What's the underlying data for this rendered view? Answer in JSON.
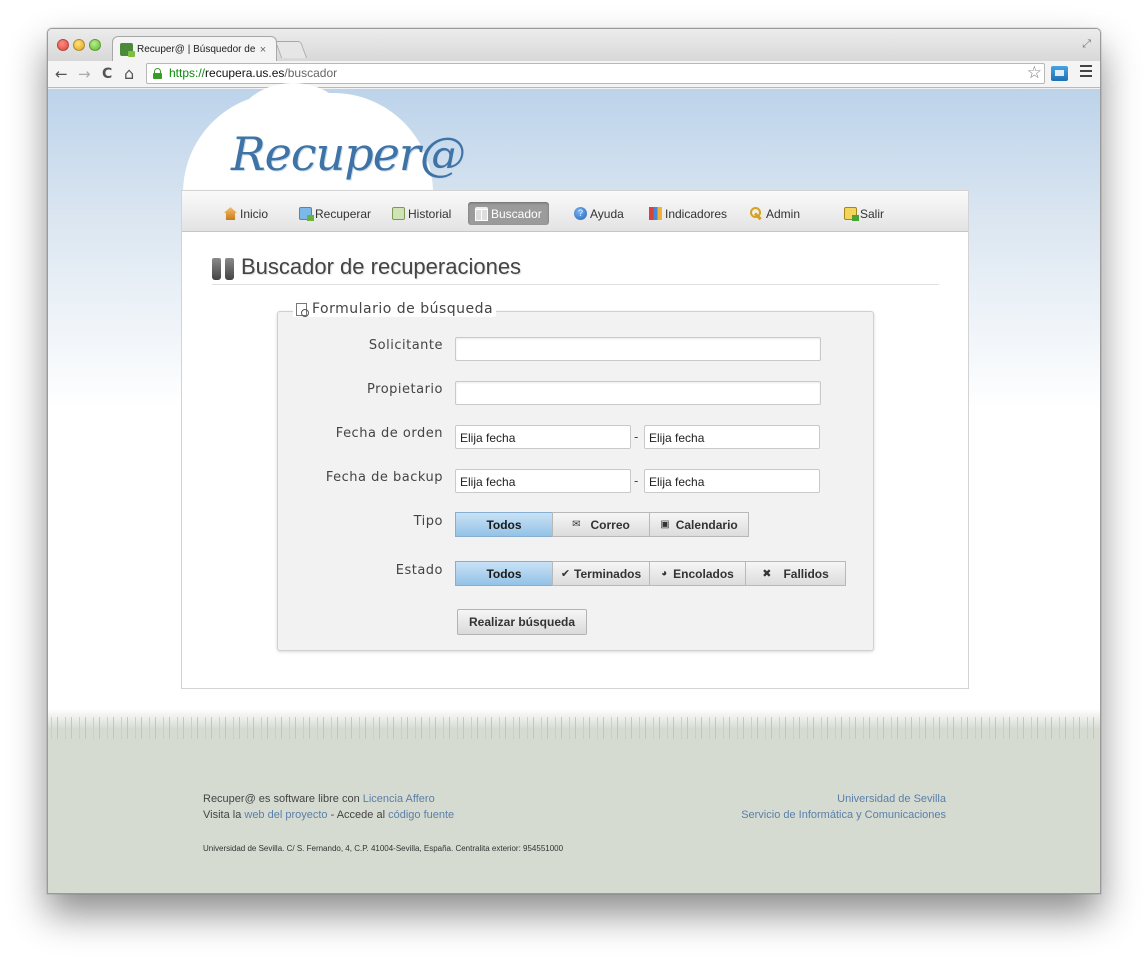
{
  "browser": {
    "tab_title": "Recuper@ | Búsquedor de",
    "tab_close": "×",
    "url_scheme": "https://",
    "url_host": "recupera.us.es",
    "url_path": "/buscador",
    "back": "←",
    "forward": "→",
    "reload": "C",
    "home": "⌂",
    "star": "☆",
    "resize": "⤢"
  },
  "site": {
    "logo_text": "Recuper@"
  },
  "nav": {
    "items": [
      {
        "label": "Inicio",
        "icon": "home-icon"
      },
      {
        "label": "Recuperar",
        "icon": "recover-icon"
      },
      {
        "label": "Historial",
        "icon": "history-icon"
      },
      {
        "label": "Buscador",
        "icon": "binoculars-icon",
        "active": true
      },
      {
        "label": "Ayuda",
        "icon": "help-icon"
      },
      {
        "label": "Indicadores",
        "icon": "chart-icon"
      },
      {
        "label": "Admin",
        "icon": "key-icon"
      },
      {
        "label": "Salir",
        "icon": "exit-icon"
      }
    ]
  },
  "page": {
    "title": "Buscador de recuperaciones"
  },
  "form": {
    "legend": "Formulario de búsqueda",
    "solicitante_label": "Solicitante",
    "solicitante_value": "",
    "propietario_label": "Propietario",
    "propietario_value": "",
    "fecha_orden_label": "Fecha de orden",
    "fecha_orden_from": "Elija fecha",
    "fecha_orden_to": "Elija fecha",
    "fecha_backup_label": "Fecha de backup",
    "fecha_backup_from": "Elija fecha",
    "fecha_backup_to": "Elija fecha",
    "range_separator": "-",
    "tipo_label": "Tipo",
    "tipo_options": [
      {
        "label": "Todos",
        "glyph": "",
        "active": true
      },
      {
        "label": "Correo",
        "glyph": "✉",
        "active": false
      },
      {
        "label": "Calendario",
        "glyph": "▣",
        "active": false
      }
    ],
    "estado_label": "Estado",
    "estado_options": [
      {
        "label": "Todos",
        "glyph": "",
        "active": true
      },
      {
        "label": "Terminados",
        "glyph": "✔",
        "active": false
      },
      {
        "label": "Encolados",
        "glyph": "◕",
        "active": false
      },
      {
        "label": "Fallidos",
        "glyph": "✖",
        "active": false
      }
    ],
    "submit_label": "Realizar búsqueda"
  },
  "footer": {
    "line1_prefix": "Recuper@ es software libre con ",
    "line1_link": "Licencia Affero",
    "line2_prefix": "Visita la ",
    "line2_link1": "web del proyecto",
    "line2_mid": " - Accede al ",
    "line2_link2": "código fuente",
    "right_line1": "Universidad de Sevilla",
    "right_line2": "Servicio de Informática y Comunicaciones",
    "address": "Universidad de Sevilla. C/ S. Fernando, 4, C.P. 41004-Sevilla, España. Centralita exterior: 954551000"
  },
  "colors": {
    "accent": "#5a7fa8",
    "active_segment": "#93c2e6",
    "active_nav": "#9b9b9b",
    "logo": "#3f73a6"
  }
}
